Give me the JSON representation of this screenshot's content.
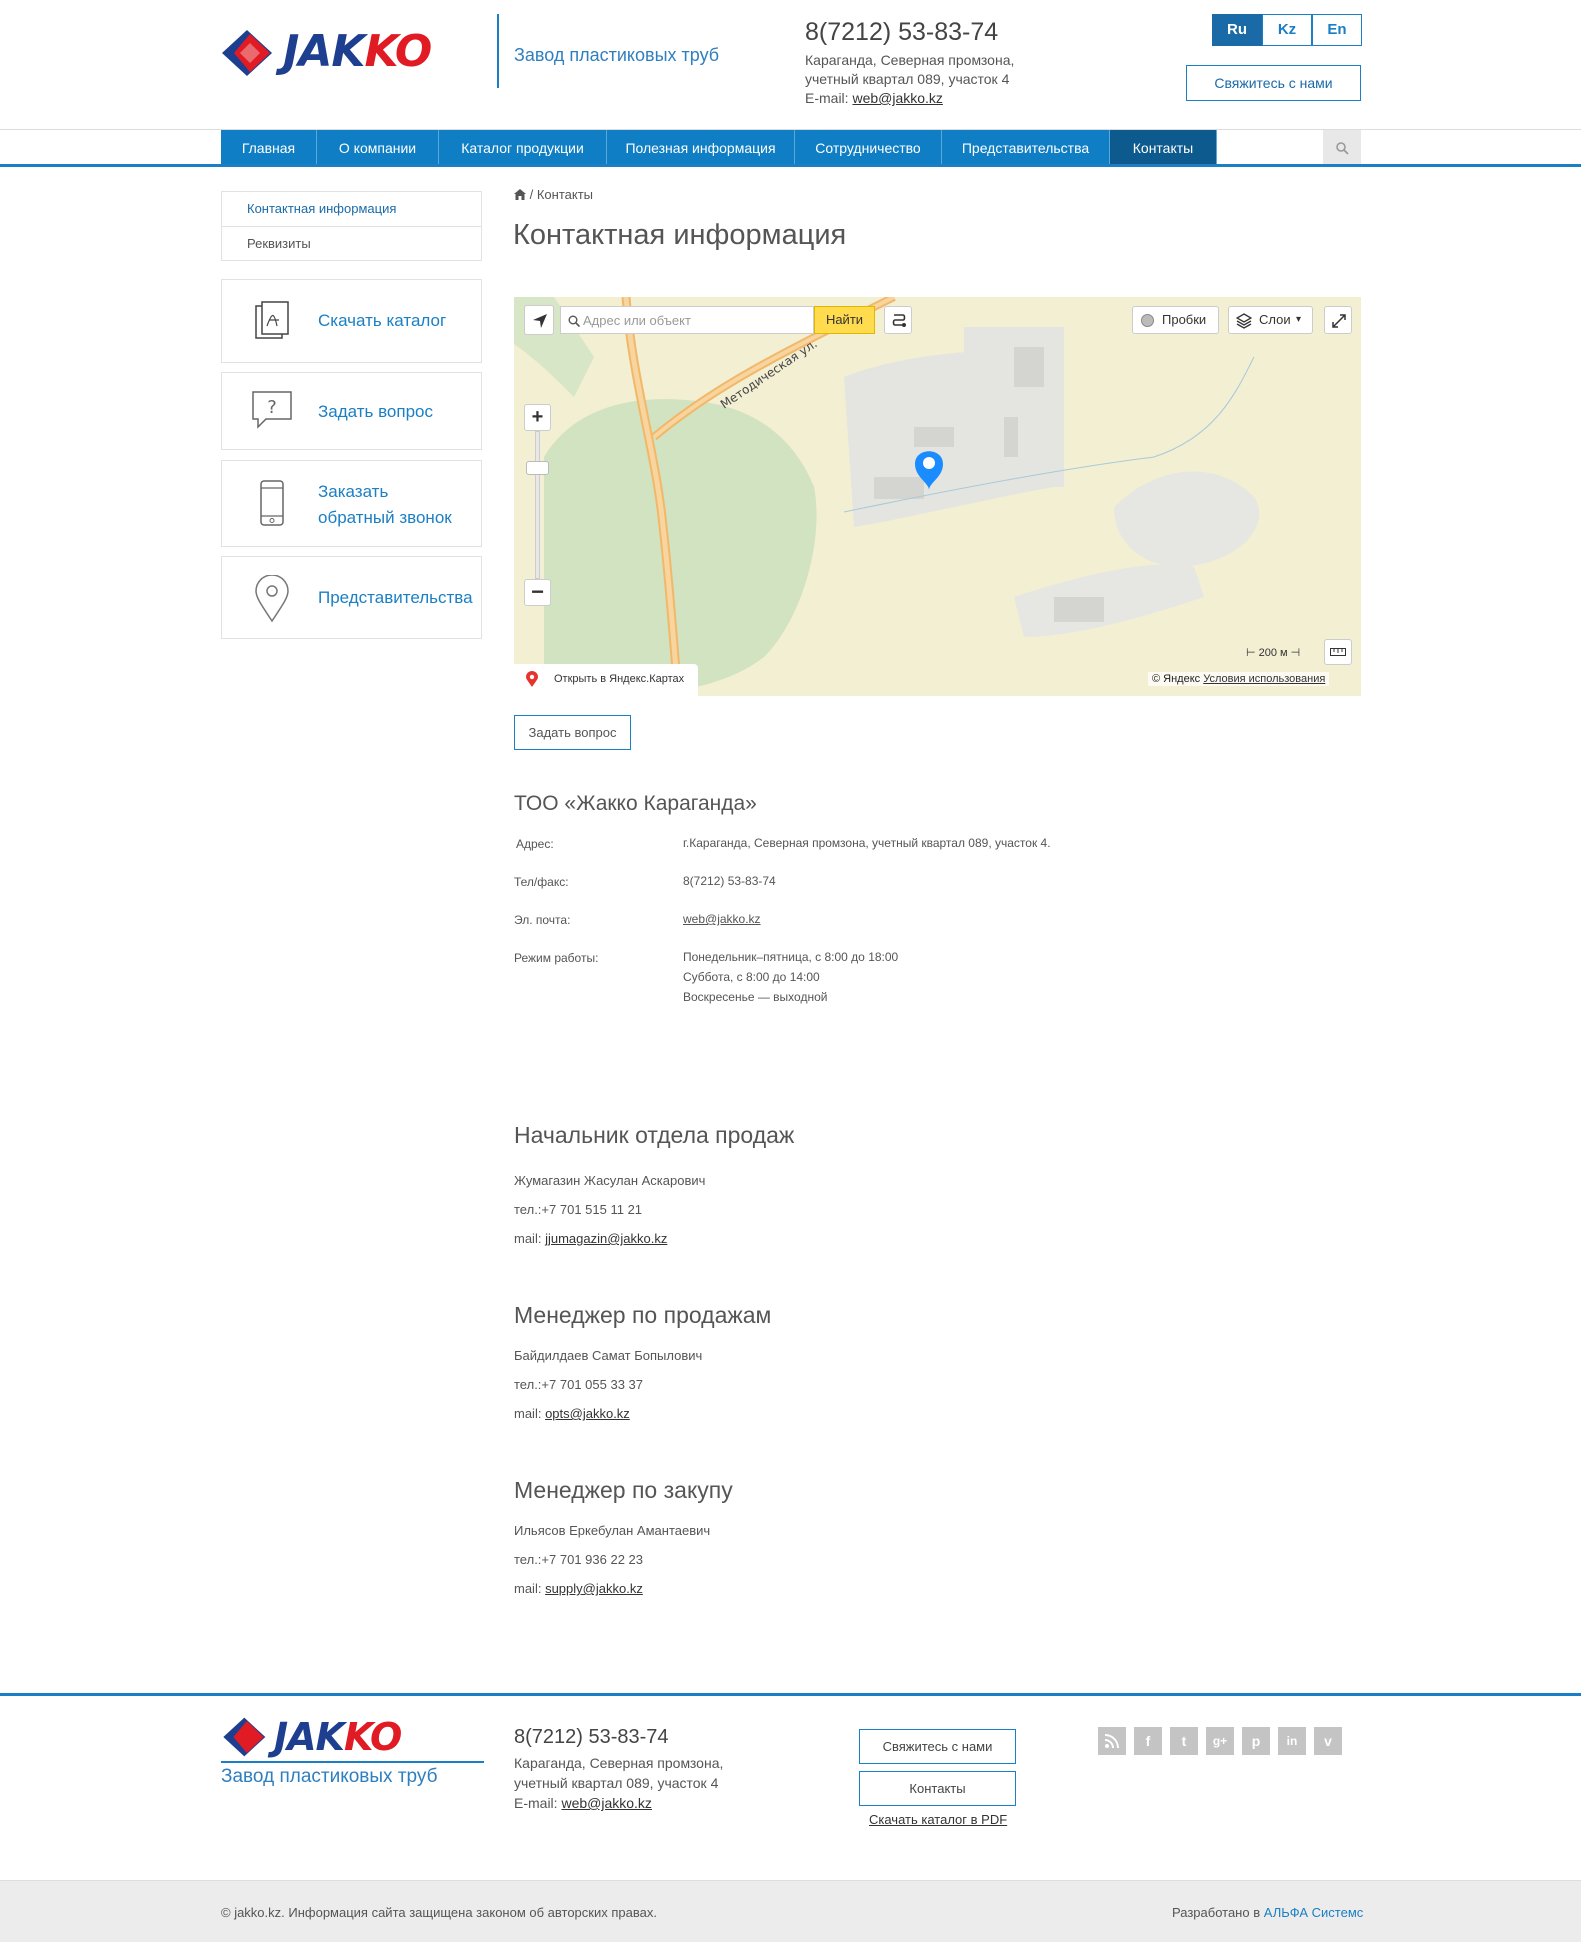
{
  "header": {
    "logo_left": "JAK",
    "logo_right": "KO",
    "tagline": "Завод пластиковых труб",
    "phone": "8(7212) 53-83-74",
    "address_line1": "Караганда, Северная промзона,",
    "address_line2": "учетный квартал 089, участок 4",
    "email_label": "E-mail:",
    "email": "web@jakko.kz",
    "languages": [
      "Ru",
      "Kz",
      "En"
    ],
    "active_language": "Ru",
    "contact_button": "Свяжитесь с нами"
  },
  "nav": {
    "items": [
      "Главная",
      "О компании",
      "Каталог продукции",
      "Полезная информация",
      "Сотрудничество",
      "Представительства",
      "Контакты"
    ],
    "active": "Контакты"
  },
  "sidebar": {
    "links": [
      "Контактная информация",
      "Реквизиты"
    ],
    "cards": {
      "catalog": "Скачать каталог",
      "question": "Задать вопрос",
      "callback_line1": "Заказать",
      "callback_line2": "обратный звонок",
      "offices": "Представительства"
    }
  },
  "breadcrumb": {
    "current": "Контакты"
  },
  "page_title": "Контактная информация",
  "map": {
    "search_placeholder": "Адрес или объект",
    "find_button": "Найти",
    "traffic_button": "Пробки",
    "layers_button": "Слои",
    "street_label": "Методическая ул.",
    "scale": "200 м",
    "open_in_yandex": "Открыть в Яндекс.Картах",
    "copyright": "© Яндекс",
    "terms": "Условия использования"
  },
  "ask_button": "Задать вопрос",
  "company": {
    "title": "ТОО «Жакко Караганда»",
    "address_label": "Адрес:",
    "address": "г.Караганда, Северная промзона, учетный квартал 089, участок 4.",
    "phone_label": "Тел/факс:",
    "phone": "8(7212) 53-83-74",
    "email_label": "Эл. почта:",
    "email": "web@jakko.kz",
    "hours_label": "Режим работы:",
    "hours_line1": "Понедельник–пятница, с 8:00 до 18:00",
    "hours_line2": "Суббота, с 8:00 до 14:00",
    "hours_line3": "Воскресенье — выходной"
  },
  "contacts": [
    {
      "title": "Начальник отдела продаж",
      "name": "Жумагазин Жасулан Аскарович",
      "tel_label": "тел.:",
      "tel": "+7 701 515 11 21",
      "mail_label": "mail:",
      "mail": "jjumagazin@jakko.kz"
    },
    {
      "title": "Менеджер по продажам",
      "name": "Байдилдаев Самат Бопылович",
      "tel_label": "тел.:",
      "tel": "+7 701 055 33 37",
      "mail_label": "mail:",
      "mail": "opts@jakko.kz"
    },
    {
      "title": "Менеджер по закупу",
      "name": "Ильясов Еркебулан Амантаевич",
      "tel_label": "тел.:",
      "tel": "+7 701 936 22 23",
      "mail_label": "mail:",
      "mail": "supply@jakko.kz"
    }
  ],
  "footer": {
    "logo_left": "JAK",
    "logo_right": "KO",
    "tagline": "Завод пластиковых труб",
    "phone": "8(7212) 53-83-74",
    "address_line1": "Караганда, Северная промзона,",
    "address_line2": "учетный квартал 089, участок 4",
    "email_label": "E-mail:",
    "email": "web@jakko.kz",
    "contact_button": "Свяжитесь с нами",
    "contacts_button": "Контакты",
    "pdf_link": "Скачать каталог в PDF",
    "social": [
      "rss",
      "facebook",
      "twitter",
      "google-plus",
      "pinterest",
      "linkedin",
      "vimeo"
    ],
    "copyright": "© jakko.kz. Информация сайта защищена законом об авторских правах.",
    "developed_by": "Разработано в",
    "developer": "АЛЬФА Системс"
  },
  "colors": {
    "brand_blue": "#0f7ec5",
    "nav_active": "#0d5a8e",
    "logo_blue": "#1e3f8f",
    "logo_red": "#e01b24"
  }
}
